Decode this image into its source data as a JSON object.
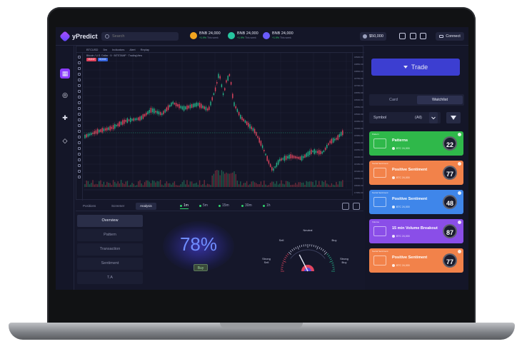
{
  "app": {
    "name": "yPredict"
  },
  "search": {
    "placeholder": "Search"
  },
  "tickers": [
    {
      "price": "BNB 24,000",
      "change": "+1.9%",
      "period": "This week",
      "color": "#f3a51f"
    },
    {
      "price": "BNB 24,000",
      "change": "+1.9%",
      "period": "This week",
      "color": "#26c6a0"
    },
    {
      "price": "BNB 24,000",
      "change": "+1.9%",
      "period": "This week",
      "color": "#6a5cff"
    }
  ],
  "wallet": {
    "balance": "$50,000"
  },
  "connect": {
    "label": "Connect"
  },
  "chart": {
    "legend": "Bitcoin / U.S. Dollar · 5 · BITSTAMP · TradingView",
    "toolbar": [
      "BTCUSD",
      "5m",
      "Indicators",
      "Alert",
      "Replay"
    ],
    "price_ticks": [
      "18900.00",
      "18850.00",
      "18800.00",
      "18750.00",
      "18700.00",
      "18650.00",
      "18600.00",
      "18550.00",
      "18500.00",
      "18450.00",
      "18400.00",
      "18350.00",
      "18300.00",
      "18250.00",
      "18200.00",
      "18150.00",
      "18100.00",
      "18050.00",
      "18000.00",
      "17950.00"
    ]
  },
  "bottom_tabs": [
    {
      "label": "Positions",
      "active": false
    },
    {
      "label": "Screener",
      "active": false
    },
    {
      "label": "Analysis",
      "active": true
    }
  ],
  "timeframes": [
    {
      "label": "1m",
      "active": true
    },
    {
      "label": "5m",
      "active": false
    },
    {
      "label": "15m",
      "active": false
    },
    {
      "label": "30m",
      "active": false
    },
    {
      "label": "1h",
      "active": false
    }
  ],
  "analysis_menu": [
    {
      "label": "Overview",
      "active": true
    },
    {
      "label": "Pattern",
      "active": false
    },
    {
      "label": "Transaction",
      "active": false
    },
    {
      "label": "Sentiment",
      "active": false
    },
    {
      "label": "T.A",
      "active": false
    }
  ],
  "prediction": {
    "percent": "78%",
    "signal": "Buy"
  },
  "gauge": {
    "neutral": "Neutral",
    "sell": "Sell",
    "buy": "Buy",
    "strong_sell": "Strong\nSell",
    "strong_buy": "Strong\nBuy",
    "value": 0.35
  },
  "trade": {
    "label": "Trade"
  },
  "segment": [
    {
      "label": "Card",
      "active": false
    },
    {
      "label": "Watchlist",
      "active": true
    }
  ],
  "symbol_filter": {
    "label": "Symbol",
    "value": "(All)"
  },
  "cards": [
    {
      "tag": "Pattern",
      "title": "Patterns",
      "sub": "BTC 24,000",
      "score": "22",
      "color": "#2fb84a"
    },
    {
      "tag": "Social Sentiment",
      "title": "Positive Sentiment",
      "sub": "BTC 24,000",
      "score": "77",
      "color": "#f2824a"
    },
    {
      "tag": "Social Sentiment",
      "title": "Positive Sentiment",
      "sub": "BTC 24,000",
      "score": "48",
      "color": "#3f86ea"
    },
    {
      "tag": "Volume",
      "title": "15 min Volume Breakout",
      "sub": "BTC 24,000",
      "score": "87",
      "color": "#8a4ee8"
    },
    {
      "tag": "Social Sentiment",
      "title": "Positive Sentiment",
      "sub": "BTC 24,000",
      "score": "77",
      "color": "#f2824a"
    }
  ]
}
